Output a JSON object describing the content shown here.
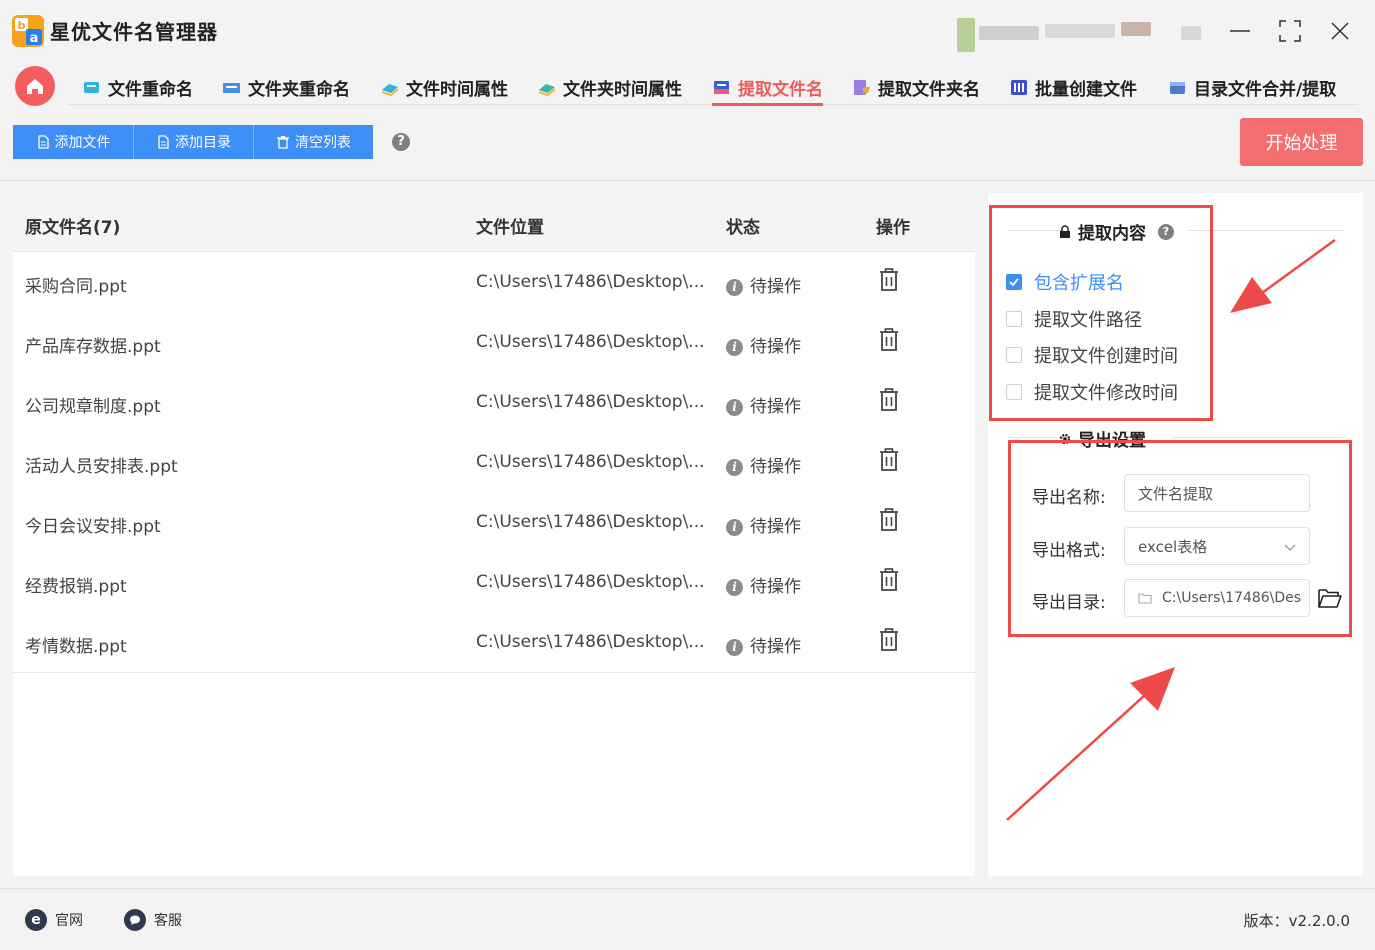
{
  "app": {
    "title": "星优文件名管理器"
  },
  "nav": {
    "tabs": [
      {
        "label": "文件重命名"
      },
      {
        "label": "文件夹重命名"
      },
      {
        "label": "文件时间属性"
      },
      {
        "label": "文件夹时间属性"
      },
      {
        "label": "提取文件名",
        "active": true
      },
      {
        "label": "提取文件夹名"
      },
      {
        "label": "批量创建文件"
      },
      {
        "label": "目录文件合并/提取"
      }
    ]
  },
  "toolbar": {
    "add_file": "添加文件",
    "add_dir": "添加目录",
    "clear_list": "清空列表",
    "help": "?",
    "start": "开始处理"
  },
  "table": {
    "headers": {
      "name": "原文件名(7)",
      "location": "文件位置",
      "status": "状态",
      "action": "操作"
    },
    "rows": [
      {
        "name": "采购合同.ppt",
        "location": "C:\\Users\\17486\\Desktop\\...",
        "status": "待操作"
      },
      {
        "name": "产品库存数据.ppt",
        "location": "C:\\Users\\17486\\Desktop\\...",
        "status": "待操作"
      },
      {
        "name": "公司规章制度.ppt",
        "location": "C:\\Users\\17486\\Desktop\\...",
        "status": "待操作"
      },
      {
        "name": "活动人员安排表.ppt",
        "location": "C:\\Users\\17486\\Desktop\\...",
        "status": "待操作"
      },
      {
        "name": "今日会议安排.ppt",
        "location": "C:\\Users\\17486\\Desktop\\...",
        "status": "待操作"
      },
      {
        "name": "经费报销.ppt",
        "location": "C:\\Users\\17486\\Desktop\\...",
        "status": "待操作"
      },
      {
        "name": "考情数据.ppt",
        "location": "C:\\Users\\17486\\Desktop\\...",
        "status": "待操作"
      }
    ]
  },
  "extract": {
    "title": "提取内容",
    "options": [
      {
        "label": "包含扩展名",
        "checked": true
      },
      {
        "label": "提取文件路径",
        "checked": false
      },
      {
        "label": "提取文件创建时间",
        "checked": false
      },
      {
        "label": "提取文件修改时间",
        "checked": false
      }
    ]
  },
  "export": {
    "title": "导出设置",
    "name_label": "导出名称:",
    "name_value": "文件名提取",
    "format_label": "导出格式:",
    "format_value": "excel表格",
    "dir_label": "导出目录:",
    "dir_value": "C:\\Users\\17486\\Des"
  },
  "footer": {
    "website": "官网",
    "support": "客服",
    "version": "版本：v2.2.0.0"
  },
  "colors": {
    "accent": "#ef5b5b",
    "primary": "#3e8ef7",
    "annotation": "#ee4a4a"
  }
}
